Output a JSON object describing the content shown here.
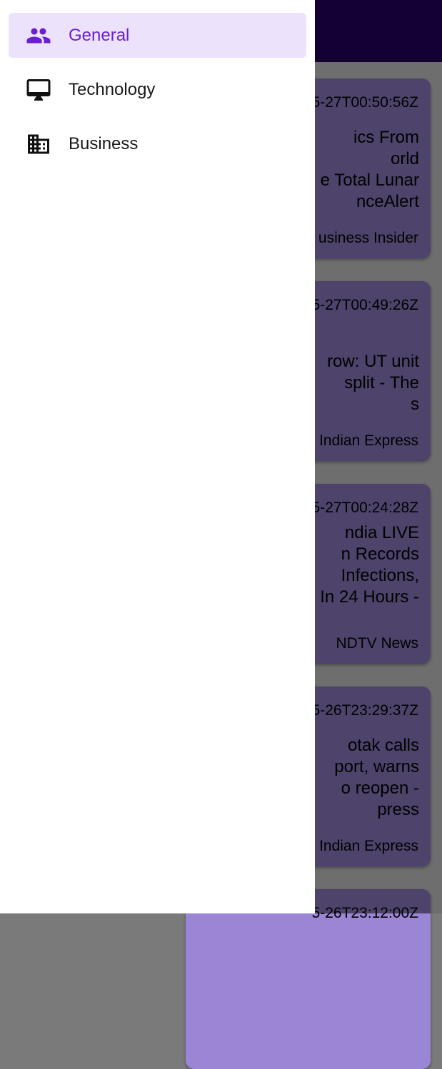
{
  "drawer": {
    "items": [
      {
        "label": "General",
        "icon": "people-icon",
        "active": true
      },
      {
        "label": "Technology",
        "icon": "desktop-icon",
        "active": false
      },
      {
        "label": "Business",
        "icon": "building-icon",
        "active": false
      }
    ]
  },
  "feed": {
    "cards": [
      {
        "date": "5-27T00:50:56Z",
        "title": "ics From\norld\ne Total Lunar\nnceAlert",
        "source": "usiness Insider"
      },
      {
        "date": "5-27T00:49:26Z",
        "title": "row: UT unit\nsplit - The\ns",
        "source": "Indian Express"
      },
      {
        "date": "5-27T00:24:28Z",
        "title": "ndia LIVE\nn Records\nInfections,\nIn 24 Hours -",
        "source": "NDTV News"
      },
      {
        "date": "5-26T23:29:37Z",
        "title": "otak calls\nport, warns\no reopen -\npress",
        "source": "Indian Express"
      },
      {
        "date": "5-26T23:12:00Z",
        "title": "",
        "source": ""
      }
    ]
  },
  "colors": {
    "app_bar": "#2a0066",
    "card": "#9b86d6",
    "active_item_bg": "#ede2fb",
    "active_item_text": "#6a1fd3"
  }
}
